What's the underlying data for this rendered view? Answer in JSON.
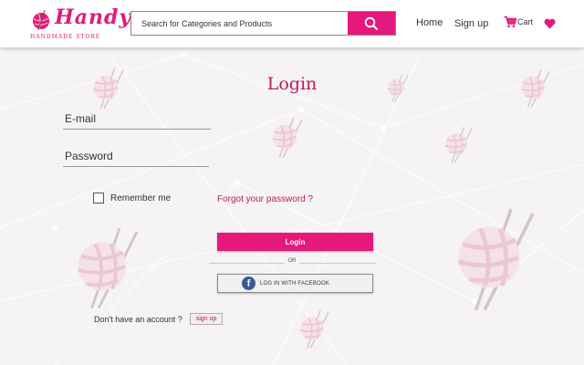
{
  "brand": {
    "name": "Handy",
    "tagline": "HANDMADE STORE",
    "color": "#e4197b"
  },
  "search": {
    "placeholder": "Search for Categories and Products",
    "button_icon": "search-icon"
  },
  "nav": {
    "home": "Home",
    "signup": "Sign up",
    "cart": "Cart",
    "cart_icon": "cart-icon",
    "wishlist_icon": "heart-icon"
  },
  "login": {
    "title": "Login",
    "email_placeholder": "E-mail",
    "password_placeholder": "Password",
    "remember_me": "Remember me",
    "forgot_password": "Forgot your password ?",
    "submit": "Login",
    "or": "OR",
    "facebook": "LOG IN WITH FACEBOOK",
    "no_account": "Don't have an account ?",
    "signup": "sign up"
  },
  "colors": {
    "accent": "#e4197b",
    "title": "#c2185b",
    "facebook": "#3b5998",
    "background": "#f5f3f4"
  }
}
